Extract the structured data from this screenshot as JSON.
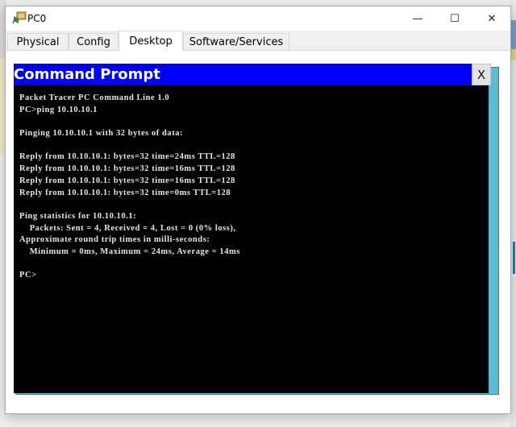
{
  "window": {
    "title": "PC0",
    "icon": "pc-device-icon",
    "controls": {
      "minimize": "—",
      "maximize": "☐",
      "close": "✕"
    }
  },
  "tabs": [
    {
      "label": "Physical",
      "active": false
    },
    {
      "label": "Config",
      "active": false
    },
    {
      "label": "Desktop",
      "active": true
    },
    {
      "label": "Software/Services",
      "active": false
    }
  ],
  "command_prompt": {
    "title": "Command Prompt",
    "close_label": "X",
    "lines": [
      "Packet Tracer PC Command Line 1.0",
      "PC>ping 10.10.10.1",
      "",
      "Pinging 10.10.10.1 with 32 bytes of data:",
      "",
      "Reply from 10.10.10.1: bytes=32 time=24ms TTL=128",
      "Reply from 10.10.10.1: bytes=32 time=16ms TTL=128",
      "Reply from 10.10.10.1: bytes=32 time=16ms TTL=128",
      "Reply from 10.10.10.1: bytes=32 time=0ms TTL=128",
      "",
      "Ping statistics for 10.10.10.1:",
      "    Packets: Sent = 4, Received = 4, Lost = 0 (0% loss),",
      "Approximate round trip times in milli-seconds:",
      "    Minimum = 0ms, Maximum = 24ms, Average = 14ms",
      "",
      "PC>"
    ]
  },
  "colors": {
    "cmd_titlebar": "#0000fb",
    "desktop_bg": "#56bdd3",
    "terminal_bg": "#000000",
    "terminal_text": "#e6e6e6"
  }
}
